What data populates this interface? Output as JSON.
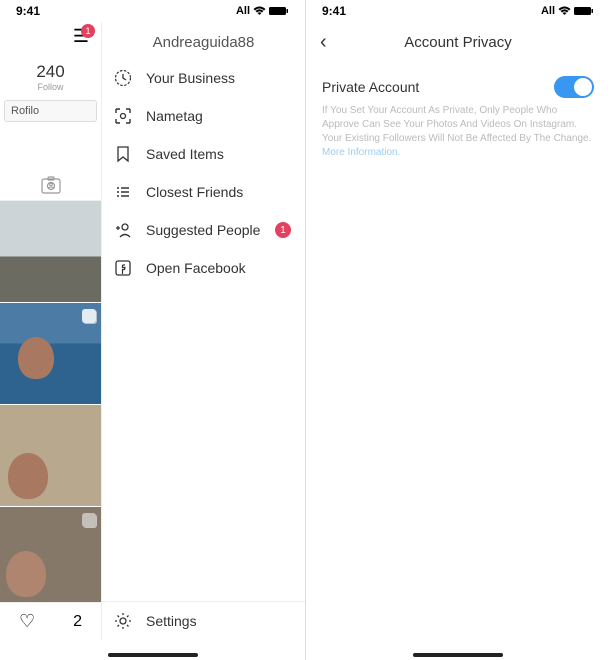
{
  "status": {
    "time": "9:41",
    "carrier": "All"
  },
  "left": {
    "hamburger_badge": "1",
    "username": "Andreaguida88",
    "stat_value": "240",
    "stat_label": "Follow",
    "search_value": "Rofilo",
    "menu": {
      "business": "Your Business",
      "nametag": "Nametag",
      "saved": "Saved Items",
      "closest": "Closest Friends",
      "suggested": "Suggested People",
      "suggested_badge": "1",
      "facebook": "Open Facebook",
      "settings": "Settings"
    },
    "bottom_count": "2"
  },
  "right": {
    "title": "Account Privacy",
    "toggle_label": "Private Account",
    "desc": "If You Set Your Account As Private, Only People Who Approve Can See Your Photos And Videos On Instagram. Your Existing Followers Will Not Be Affected By The Change.",
    "more": "More Information."
  }
}
